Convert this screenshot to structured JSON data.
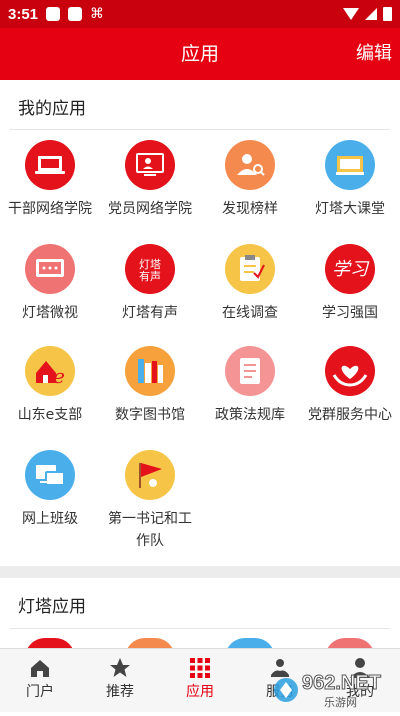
{
  "status": {
    "time": "3:51"
  },
  "header": {
    "title": "应用",
    "edit": "编辑"
  },
  "my_apps": {
    "title": "我的应用",
    "items": [
      {
        "label": "干部网络学院",
        "icon": "laptop-icon",
        "color": "#e3121b"
      },
      {
        "label": "党员网络学院",
        "icon": "monitor-person-icon",
        "color": "#e3121b"
      },
      {
        "label": "发现榜样",
        "icon": "person-search-icon",
        "color": "#f58a4f"
      },
      {
        "label": "灯塔大课堂",
        "icon": "classroom-icon",
        "color": "#4aaeeb"
      },
      {
        "label": "灯塔微视",
        "icon": "tv-icon",
        "color": "#f07373"
      },
      {
        "label": "灯塔有声",
        "icon": "audio-text-icon",
        "color": "#e3121b"
      },
      {
        "label": "在线调查",
        "icon": "clipboard-icon",
        "color": "#f6c547"
      },
      {
        "label": "学习强国",
        "icon": "xuexi-icon",
        "color": "#e3121b"
      },
      {
        "label": "山东e支部",
        "icon": "house-e-icon",
        "color": "#f6c547"
      },
      {
        "label": "数字图书馆",
        "icon": "books-icon",
        "color": "#f6a13c"
      },
      {
        "label": "政策法规库",
        "icon": "document-icon",
        "color": "#f49494"
      },
      {
        "label": "党群服务中心",
        "icon": "hands-heart-icon",
        "color": "#e3121b"
      },
      {
        "label": "网上班级",
        "icon": "screens-icon",
        "color": "#4aaeeb"
      },
      {
        "label": "第一书记和工作队",
        "icon": "flag-icon",
        "color": "#f6c547"
      }
    ]
  },
  "lighthouse_apps": {
    "title": "灯塔应用"
  },
  "tabs": [
    {
      "label": "门户",
      "icon": "home-icon"
    },
    {
      "label": "推荐",
      "icon": "star-icon"
    },
    {
      "label": "应用",
      "icon": "grid-icon",
      "active": true
    },
    {
      "label": "服务",
      "icon": "service-icon"
    },
    {
      "label": "我的",
      "icon": "user-icon"
    }
  ],
  "watermark": {
    "text": "962.NET",
    "subtext": "乐游网"
  },
  "colors": {
    "brand": "#e50012",
    "status_bar": "#c9000d"
  }
}
